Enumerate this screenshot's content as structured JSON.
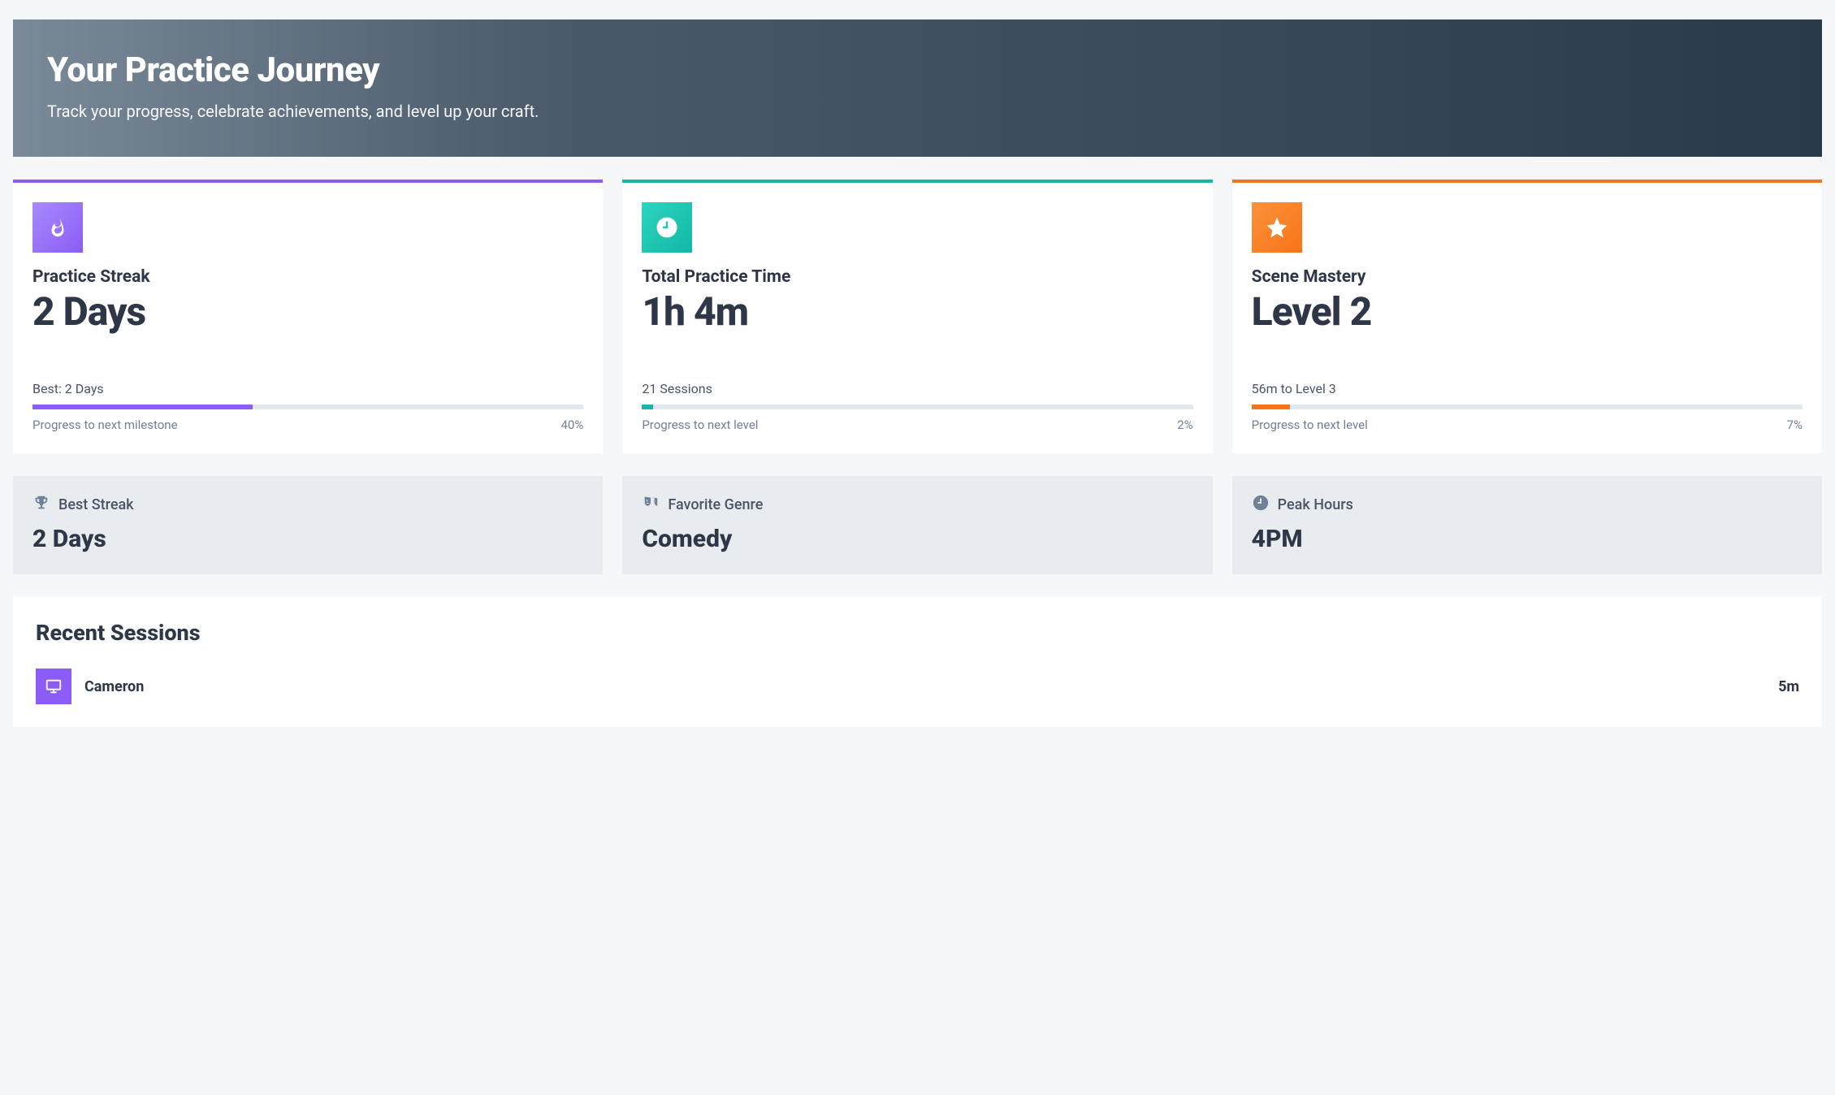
{
  "hero": {
    "title": "Your Practice Journey",
    "subtitle": "Track your progress, celebrate achievements, and level up your craft."
  },
  "cards": [
    {
      "label": "Practice Streak",
      "value": "2 Days",
      "sub": "Best: 2 Days",
      "progress_label": "Progress to next milestone",
      "progress_pct_text": "40%",
      "progress_pct": 40,
      "color": "purple",
      "icon": "fire"
    },
    {
      "label": "Total Practice Time",
      "value": "1h 4m",
      "sub": "21 Sessions",
      "progress_label": "Progress to next level",
      "progress_pct_text": "2%",
      "progress_pct": 2,
      "color": "teal",
      "icon": "clock"
    },
    {
      "label": "Scene Mastery",
      "value": "Level 2",
      "sub": "56m to Level 3",
      "progress_label": "Progress to next level",
      "progress_pct_text": "7%",
      "progress_pct": 7,
      "color": "orange",
      "icon": "star"
    }
  ],
  "mini": [
    {
      "icon": "trophy",
      "label": "Best Streak",
      "value": "2 Days"
    },
    {
      "icon": "masks",
      "label": "Favorite Genre",
      "value": "Comedy"
    },
    {
      "icon": "clock",
      "label": "Peak Hours",
      "value": "4PM"
    }
  ],
  "sessions": {
    "heading": "Recent Sessions",
    "items": [
      {
        "title": "Cameron",
        "duration": "5m"
      }
    ]
  }
}
